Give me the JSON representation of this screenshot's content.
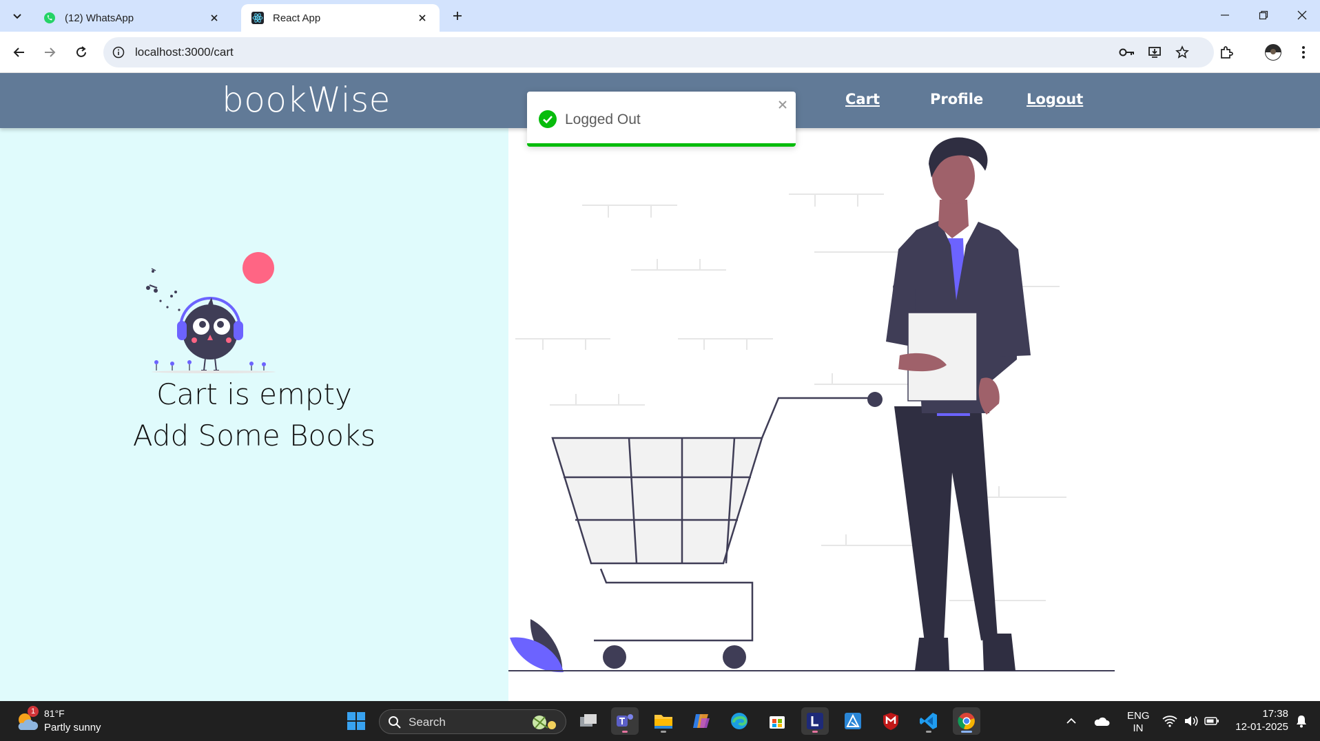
{
  "browser": {
    "tabs": [
      {
        "title": "(12) WhatsApp",
        "icon": "whatsapp-icon",
        "active": false
      },
      {
        "title": "React App",
        "icon": "react-icon",
        "active": true
      }
    ],
    "url": "localhost:3000/cart"
  },
  "app": {
    "brand": "bookWise",
    "nav": {
      "cart": "Cart",
      "profile": "Profile",
      "logout": "Logout"
    },
    "empty_title": "Cart is empty",
    "empty_subtitle": "Add Some Books",
    "toast": {
      "message": "Logged Out",
      "progress": 1.0
    }
  },
  "colors": {
    "navbar": "#617a97",
    "left_pane": "#e0fbfc",
    "toast_success": "#07bc0c",
    "illustration_accent": "#6c63ff",
    "illustration_dark": "#3f3d56",
    "illustration_pink": "#ff6584"
  },
  "taskbar": {
    "weather_temp": "81°F",
    "weather_condition": "Partly sunny",
    "weather_badge": "1",
    "search_label": "Search",
    "language": "ENG",
    "region": "IN",
    "time": "17:38",
    "date": "12-01-2025"
  }
}
